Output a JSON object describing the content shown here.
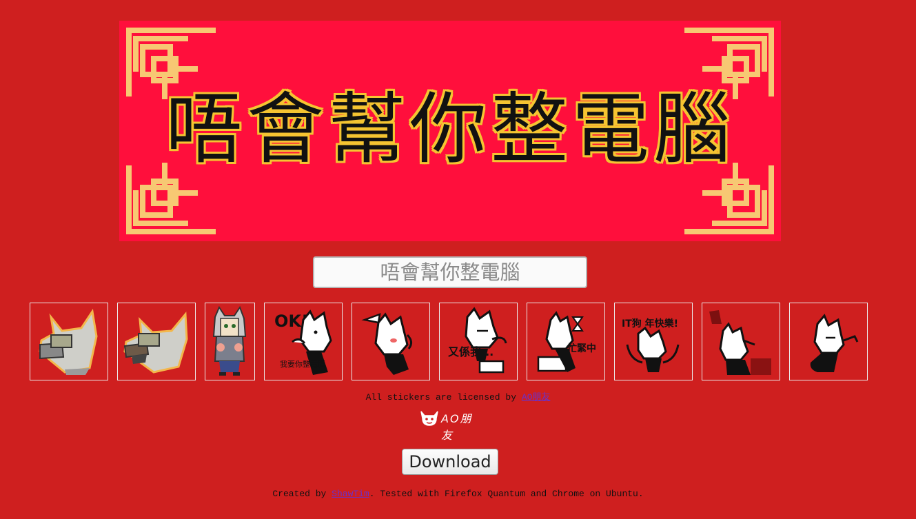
{
  "banner": {
    "title": "唔會幫你整電腦"
  },
  "input": {
    "placeholder": "唔會幫你整電腦"
  },
  "stickers": [
    {
      "name": "robot-dog-sticker-1"
    },
    {
      "name": "robot-dog-sticker-2"
    },
    {
      "name": "hoodie-girl-sticker"
    },
    {
      "name": "ok-dog-sticker",
      "text": "OK!"
    },
    {
      "name": "shrug-dog-sticker"
    },
    {
      "name": "again-dog-sticker",
      "text": "又係我..."
    },
    {
      "name": "busy-dog-sticker",
      "text": "忙緊中"
    },
    {
      "name": "new-year-dog-sticker",
      "text": "IT狗 年快樂!"
    },
    {
      "name": "shadow-dog-sticker"
    },
    {
      "name": "angry-dog-sticker"
    }
  ],
  "license": {
    "prefix": "All stickers are licensed by ",
    "link": "AO朋友"
  },
  "brand_logo": {
    "text": "AO朋友"
  },
  "download": {
    "label": "Download"
  },
  "footer": {
    "prefix": "Created by ",
    "link": "ShawTim",
    "suffix": ". Tested with Firefox Quantum and Chrome on Ubuntu."
  },
  "colors": {
    "background": "#cf1f1f",
    "banner": "#ff0f3c",
    "frame_gold": "#f7c873",
    "link": "#6a31c9"
  }
}
